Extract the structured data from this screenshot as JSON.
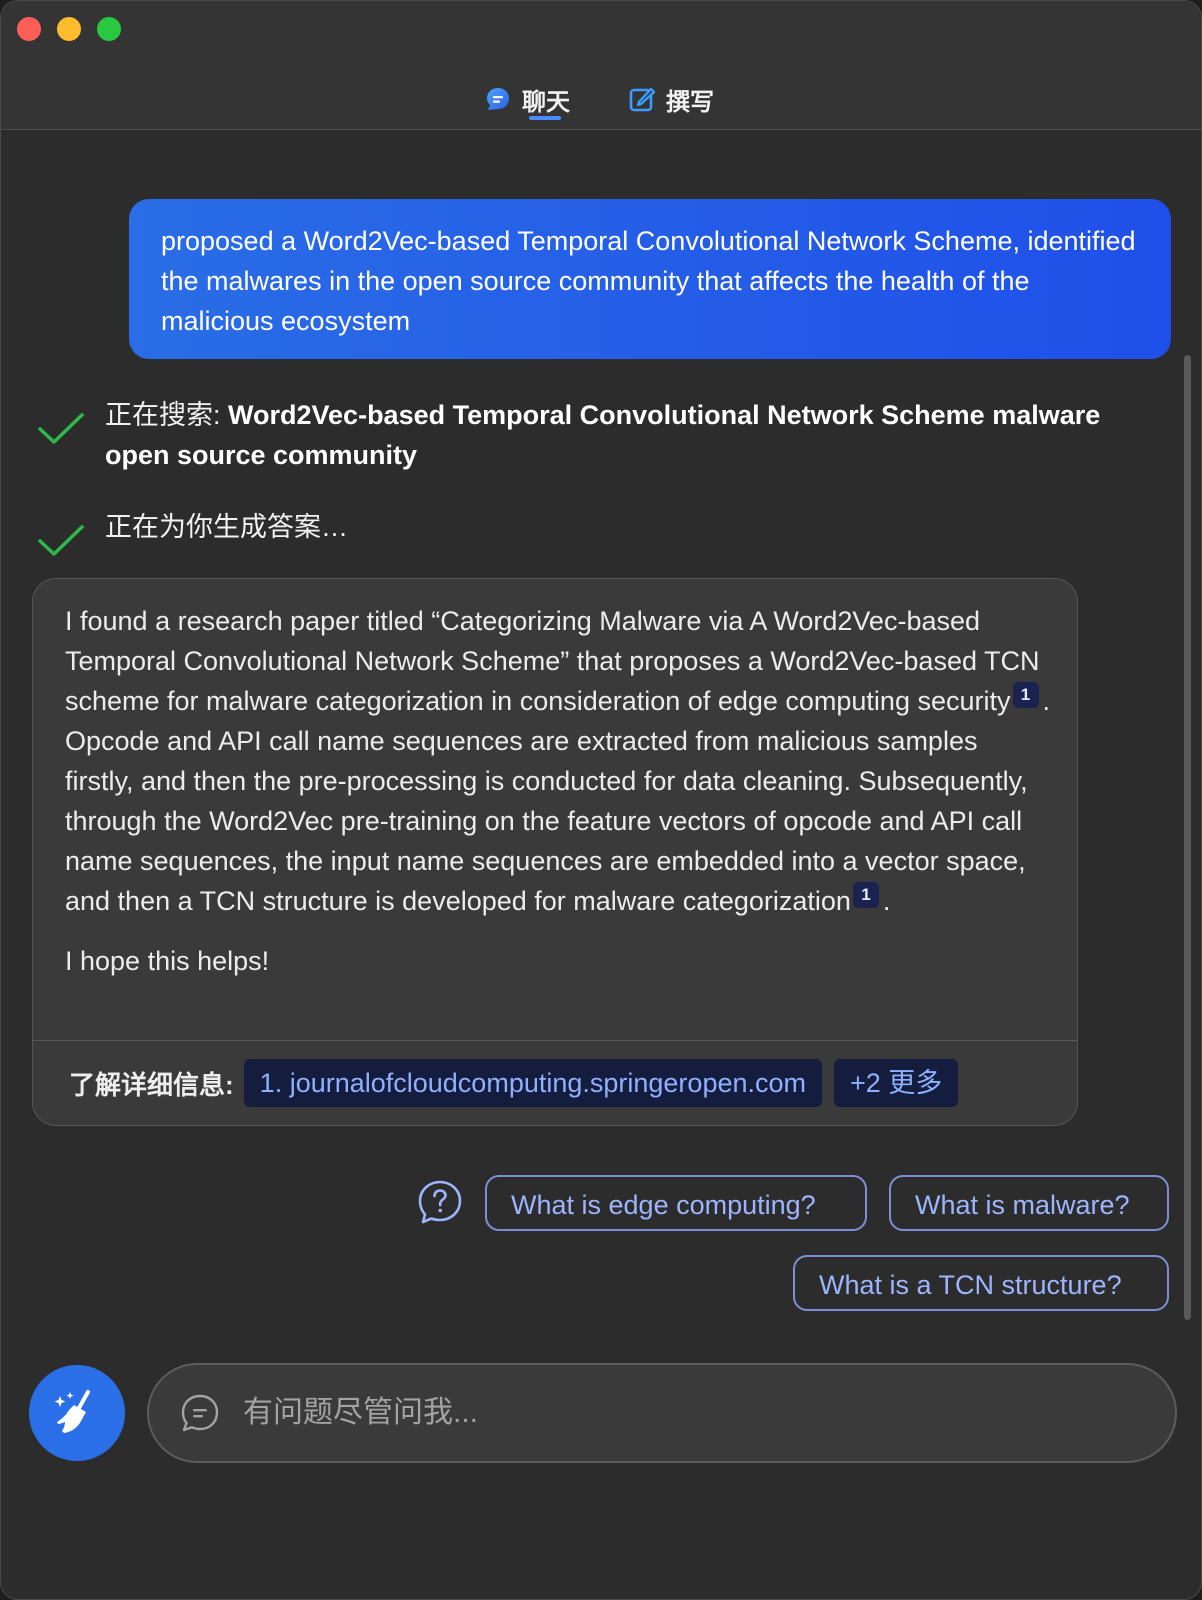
{
  "tabs": [
    {
      "label": "聊天",
      "icon": "chat-bubble-icon",
      "active": true
    },
    {
      "label": "撰写",
      "icon": "compose-icon",
      "active": false
    }
  ],
  "user_message": "proposed a Word2Vec-based Temporal Convolutional Network Scheme, identified the malwares in the open source community that affects the health of the malicious ecosystem",
  "steps": [
    {
      "prefix": "正在搜索: ",
      "query": "Word2Vec-based Temporal Convolutional Network Scheme malware open source community"
    },
    {
      "prefix": "正在为你生成答案…",
      "query": ""
    }
  ],
  "answer": {
    "p1_a": "I found a research paper titled “Categorizing Malware via A Word2Vec-based Temporal Convolutional Network Scheme” that proposes a Word2Vec-based TCN scheme for malware categorization in consideration of edge computing security",
    "cite_1": "1",
    "p1_b": ". Opcode and API call name sequences are extracted from malicious samples firstly, and then the pre-processing is conducted for data cleaning. Subsequently, through the Word2Vec pre-training on the feature vectors of opcode and API call name sequences, the input name sequences are embedded into a vector space, and then a TCN structure is developed for malware categorization",
    "cite_2": "1",
    "p1_c": ".",
    "p2": "I hope this helps!"
  },
  "sources": {
    "label": "了解详细信息:",
    "items": [
      "1. journalofcloudcomputing.springeropen.com"
    ],
    "more": "+2 更多"
  },
  "suggestions": [
    "What is edge computing?",
    "What is malware?",
    "What is a TCN structure?"
  ],
  "input": {
    "placeholder": "有问题尽管问我..."
  },
  "colors": {
    "accent": "#2a6fe8",
    "user_bubble": "#1f4fe8",
    "check": "#2db84a",
    "suggestion": "#9db4ff"
  }
}
